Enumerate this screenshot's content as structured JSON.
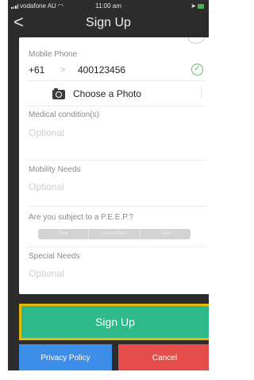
{
  "status_bar": {
    "carrier": "vodafone AU",
    "time": "11:00 am"
  },
  "nav": {
    "title": "Sign Up",
    "back_icon": "chevron-left-icon"
  },
  "form": {
    "mobile_phone": {
      "label": "Mobile Phone",
      "country_code": "+61",
      "number": "400123456",
      "valid_icon": "check-circle-icon"
    },
    "photo": {
      "label": "Choose a Photo",
      "icon": "camera-icon"
    },
    "medical": {
      "label": "Medical condition(s)",
      "placeholder": "Optional"
    },
    "mobility": {
      "label": "Mobility Needs",
      "placeholder": "Optional"
    },
    "peep": {
      "label": "Are you subject to a P.E.E.P.?",
      "options": [
        "True",
        "Unspecified",
        "False"
      ]
    },
    "special_needs": {
      "label": "Special Needs",
      "placeholder": "Optional"
    }
  },
  "actions": {
    "sign_up": "Sign Up",
    "privacy_policy": "Privacy Policy",
    "cancel": "Cancel"
  },
  "colors": {
    "sign_up": "#2eb98a",
    "sign_up_highlight": "#e7b90b",
    "privacy_policy": "#3c8ee8",
    "cancel": "#e44d49"
  }
}
